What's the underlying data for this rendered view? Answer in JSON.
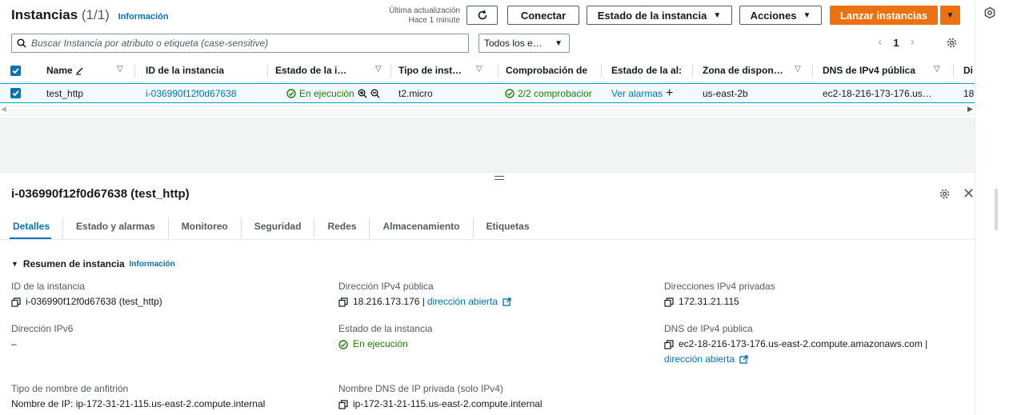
{
  "header": {
    "title": "Instancias",
    "count": "(1/1)",
    "info": "Información",
    "last_update_label": "Última actualización",
    "last_update_value": "Hace 1 minute",
    "connect": "Conectar",
    "instance_state": "Estado de la instancia",
    "actions": "Acciones",
    "launch": "Lanzar instancias"
  },
  "filter": {
    "search_placeholder": "Buscar Instancia por atributo o etiqueta (case-sensitive)",
    "select_value": "Todos los e…",
    "page": "1"
  },
  "table": {
    "columns": [
      "Name",
      "ID de la instancia",
      "Estado de la i…",
      "Tipo de inst…",
      "Comprobación de",
      "Estado de la al:",
      "Zona de dispon…",
      "DNS de IPv4 pública",
      "Di"
    ],
    "row": {
      "name": "test_http",
      "id": "i-036990f12f0d67638",
      "state": "En ejecución",
      "type": "t2.micro",
      "checks": "2/2 comprobacior",
      "alarms": "Ver alarmas",
      "zone": "us-east-2b",
      "dns": "ec2-18-216-173-176.us…",
      "extra": "18"
    }
  },
  "detail": {
    "title": "i-036990f12f0d67638 (test_http)",
    "tabs": [
      "Detalles",
      "Estado y alarmas",
      "Monitoreo",
      "Seguridad",
      "Redes",
      "Almacenamiento",
      "Etiquetas"
    ],
    "section_title": "Resumen de instancia",
    "section_info": "Información",
    "fields": {
      "instance_id_label": "ID de la instancia",
      "instance_id_value": "i-036990f12f0d67638 (test_http)",
      "ipv6_label": "Dirección IPv6",
      "ipv6_value": "–",
      "hostname_type_label": "Tipo de nombre de anfitrión",
      "hostname_type_value": "Nombre de IP: ip-172-31-21-115.us-east-2.compute.internal",
      "public_ipv4_label": "Dirección IPv4 pública",
      "public_ipv4_value": "18.216.173.176 |",
      "open_address": "dirección abierta",
      "instance_state_label": "Estado de la instancia",
      "instance_state_value": "En ejecución",
      "private_dns_label": "Nombre DNS de IP privada (solo IPv4)",
      "private_dns_value": "ip-172-31-21-115.us-east-2.compute.internal",
      "private_ipv4_label": "Direcciones IPv4 privadas",
      "private_ipv4_value": "172.31.21.115",
      "public_dns_label": "DNS de IPv4 pública",
      "public_dns_value": "ec2-18-216-173-176.us-east-2.compute.amazonaws.com |",
      "open_address_2": "dirección abierta"
    }
  },
  "colors": {
    "accent": "#0073bb",
    "primary_button": "#ec7211",
    "success": "#1d8102"
  }
}
